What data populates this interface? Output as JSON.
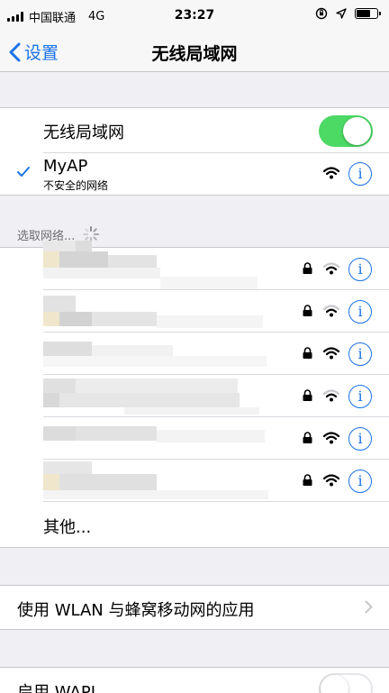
{
  "status_bar": {
    "carrier": "中国联通",
    "network": "4G",
    "time": "23:27"
  },
  "nav": {
    "back_label": "设置",
    "title": "无线局域网"
  },
  "wlan": {
    "label": "无线局域网",
    "toggle_on": true
  },
  "connected": {
    "name": "MyAP",
    "subtitle": "不安全的网络"
  },
  "networks_header": "选取网络...",
  "networks": [
    {
      "locked": true,
      "signal": "medium"
    },
    {
      "locked": true,
      "signal": "medium"
    },
    {
      "locked": true,
      "signal": "full"
    },
    {
      "locked": true,
      "signal": "medium"
    },
    {
      "locked": true,
      "signal": "full"
    },
    {
      "locked": true,
      "signal": "full"
    }
  ],
  "other_label": "其他...",
  "apps_label": "使用 WLAN 与蜂窝移动网的应用",
  "wapi": {
    "label": "启用 WAPI",
    "toggle_on": false
  },
  "colors": {
    "accent": "#1a73e8",
    "toggle_on": "#4cd964",
    "background": "#efeff4"
  }
}
